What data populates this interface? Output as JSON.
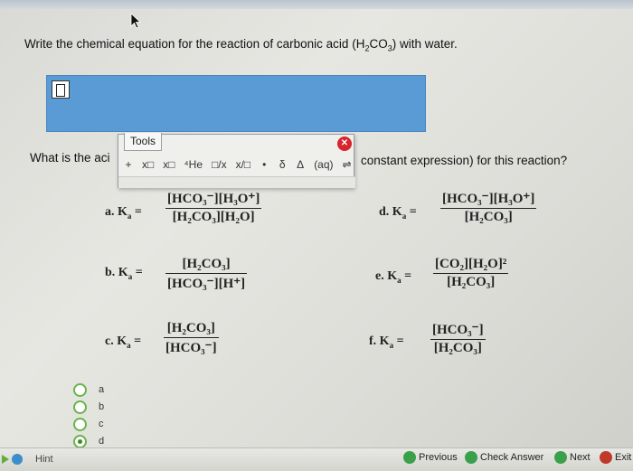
{
  "header": {
    "strip_text": ""
  },
  "question": {
    "prefix": "Write the chemical equation for the reaction of carbonic acid (H",
    "sub1": "2",
    "mid": "CO",
    "sub2": "3",
    "suffix": ") with water."
  },
  "tools": {
    "tab_label": "Tools",
    "buttons": [
      "+",
      "x□",
      "x□",
      "⁴He",
      "□/x",
      "x/□",
      "•",
      "δ",
      "Δ",
      "(aq)",
      "⇌"
    ]
  },
  "prompt": {
    "left": "What is the aci",
    "right": "constant expression) for this reaction?"
  },
  "options": [
    {
      "label": "a.  K",
      "sub": "a",
      "eq": "=",
      "num": "[HCO₃⁻][H₃O⁺]",
      "den": "[H₂CO₃][H₂O]"
    },
    {
      "label": "b.  K",
      "sub": "a",
      "eq": "=",
      "num": "[H₂CO₃]",
      "den": "[HCO₃⁻][H⁺]"
    },
    {
      "label": "c.  K",
      "sub": "a",
      "eq": "=",
      "num": "[H₂CO₃]",
      "den": "[HCO₃⁻]"
    },
    {
      "label": "d.  K",
      "sub": "a",
      "eq": "=",
      "num": "[HCO₃⁻][H₃O⁺]",
      "den": "[H₂CO₃]"
    },
    {
      "label": "e.  K",
      "sub": "a",
      "eq": "=",
      "num": "[CO₂][H₂O]²",
      "den": "[H₂CO₃]"
    },
    {
      "label": "f.  K",
      "sub": "a",
      "eq": "=",
      "num": "[HCO₃⁻]",
      "den": "[H₂CO₃]"
    }
  ],
  "choices": [
    {
      "label": "a",
      "selected": false
    },
    {
      "label": "b",
      "selected": false
    },
    {
      "label": "c",
      "selected": false
    },
    {
      "label": "d",
      "selected": true
    }
  ],
  "footer": {
    "hint": "Hint",
    "previous": "Previous",
    "check": "Check Answer",
    "next": "Next",
    "exit": "Exit"
  },
  "colors": {
    "answer_box": "#5b9bd5",
    "radio_border": "#69b34c",
    "close_button": "#d8242c"
  }
}
